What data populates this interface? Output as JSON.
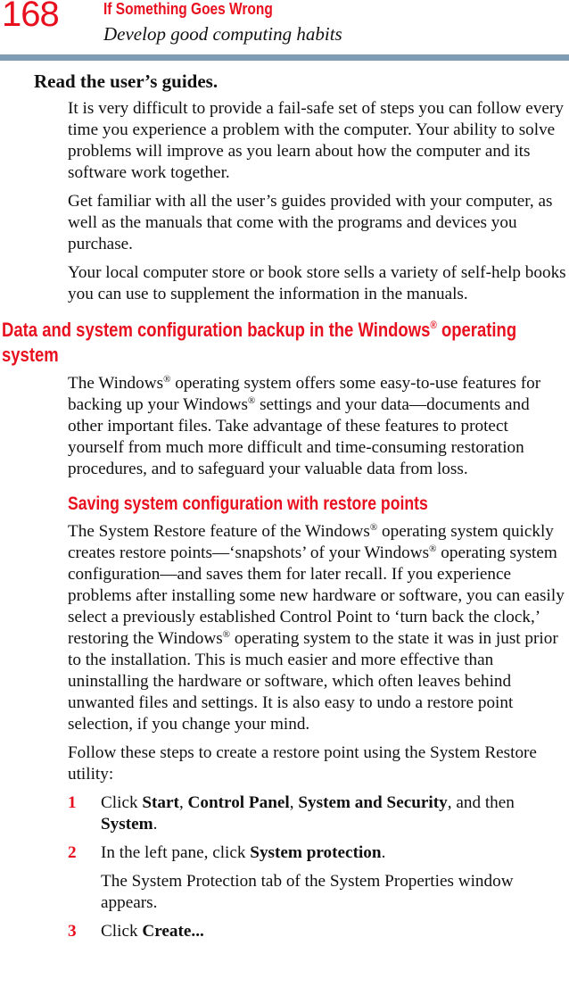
{
  "header": {
    "page_number": "168",
    "chapter_title": "If Something Goes Wrong",
    "section_title": "Develop good computing habits",
    "accent_color": "#e8101e",
    "rule_color": "#7f9cb5"
  },
  "read_guides": {
    "heading": "Read the user’s guides.",
    "paragraphs": [
      "It is very difficult to provide a fail-safe set of steps you can follow every time you experience a problem with the computer. Your ability to solve problems will improve as you learn about how the computer and its software work together.",
      "Get familiar with all the user’s guides provided with your computer, as well as the manuals that come with the programs and devices you purchase.",
      "Your local computer store or book store sells a variety of self-help books you can use to supplement the information in the manuals."
    ]
  },
  "backup_section": {
    "heading_pre": "Data and system configuration backup in the Windows",
    "heading_reg": "®",
    "heading_post": " operating system",
    "p1": {
      "a": "The Windows",
      "reg": "®",
      "b": " operating system offers some easy-to-use features for backing up your Windows",
      "c": " settings and your data—documents and other important files. Take advantage of these features to protect yourself from much more difficult and time-consuming restoration procedures, and to safeguard your valuable data from loss."
    }
  },
  "restore_section": {
    "heading": "Saving system configuration with restore points",
    "p1": {
      "a": "The System Restore feature of the Windows",
      "reg": "®",
      "b": " operating system quickly creates restore points—‘snapshots’ of your Windows",
      "c": " operating system configuration—and saves them for later recall. If you experience problems after installing some new hardware or software, you can easily select a previously established Control Point to ‘turn back the clock,’ restoring the Windows",
      "d": " operating system to the state it was in just prior to the installation. This is much easier and more effective than uninstalling the hardware or software, which often leaves behind unwanted files and settings. It is also easy to undo a restore point selection, if you change your mind."
    },
    "p2": "Follow these steps to create a restore point using the System Restore utility:",
    "steps": [
      {
        "number": "1",
        "t1": "Click ",
        "b1": "Start",
        "t2": ", ",
        "b2": "Control Panel",
        "t3": ", ",
        "b3": "System and Security",
        "t4": ", and then ",
        "b4": "System",
        "t5": "."
      },
      {
        "number": "2",
        "t1": "In the left pane, click ",
        "b1": "System protection",
        "t2": ".",
        "note": "The System Protection tab of the System Properties window appears."
      },
      {
        "number": "3",
        "t1": "Click ",
        "b1": "Create..."
      }
    ]
  }
}
